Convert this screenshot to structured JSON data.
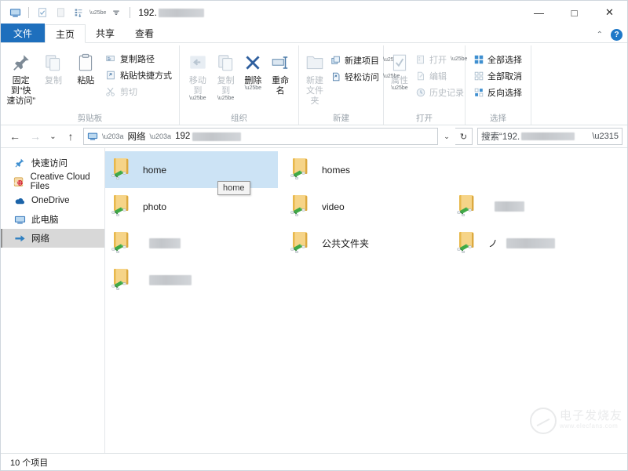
{
  "window": {
    "title_prefix": "192.",
    "title_redacted_width": 58,
    "quick_access_icons": [
      "computer-icon",
      "properties-icon",
      "new-folder-icon",
      "customize-icon",
      "dropdown-caret-icon"
    ],
    "controls": {
      "minimize": "—",
      "maximize": "□",
      "close": "✕"
    }
  },
  "tabs": {
    "file": "文件",
    "items": [
      {
        "label": "主页",
        "active": true
      },
      {
        "label": "共享",
        "active": false
      },
      {
        "label": "查看",
        "active": false
      }
    ],
    "collapse_ribbon": "⌃",
    "help": "?"
  },
  "ribbon": {
    "groups": [
      {
        "label": "剪贴板",
        "big": [
          {
            "label1": "固定到“快",
            "label2": "速访问”",
            "icon": "pin-icon",
            "dim": false
          },
          {
            "label1": "复制",
            "label2": "",
            "icon": "copy-icon",
            "dim": true
          },
          {
            "label1": "粘贴",
            "label2": "",
            "icon": "paste-icon",
            "dim": false
          }
        ],
        "small": [
          {
            "label": "复制路径",
            "icon": "copy-path-icon",
            "dim": false
          },
          {
            "label": "粘贴快捷方式",
            "icon": "paste-shortcut-icon",
            "dim": false
          },
          {
            "label": "剪切",
            "icon": "scissors-icon",
            "dim": true
          }
        ]
      },
      {
        "label": "组织",
        "big": [
          {
            "label1": "移动到",
            "label2": "",
            "icon": "move-to-icon",
            "dim": true,
            "caret": true
          },
          {
            "label1": "复制到",
            "label2": "",
            "icon": "copy-to-icon",
            "dim": true,
            "caret": true
          },
          {
            "label1": "删除",
            "label2": "",
            "icon": "delete-x-icon",
            "dim": false,
            "caret": true
          },
          {
            "label1": "重命名",
            "label2": "",
            "icon": "rename-icon",
            "dim": false
          }
        ],
        "small": []
      },
      {
        "label": "新建",
        "big": [
          {
            "label1": "新建",
            "label2": "文件夹",
            "icon": "new-folder-icon",
            "dim": true
          }
        ],
        "small": [
          {
            "label": "新建项目",
            "icon": "new-item-icon",
            "dim": false,
            "caret": true
          },
          {
            "label": "轻松访问",
            "icon": "easy-access-icon",
            "dim": false,
            "caret": true
          }
        ]
      },
      {
        "label": "打开",
        "big": [
          {
            "label1": "属性",
            "label2": "",
            "icon": "properties-icon",
            "dim": true,
            "caret": true
          }
        ],
        "small": [
          {
            "label": "打开",
            "icon": "open-icon",
            "dim": true,
            "caret": true
          },
          {
            "label": "编辑",
            "icon": "edit-icon",
            "dim": true
          },
          {
            "label": "历史记录",
            "icon": "history-icon",
            "dim": true
          }
        ]
      },
      {
        "label": "选择",
        "big": [],
        "small": [
          {
            "label": "全部选择",
            "icon": "select-all-icon",
            "dim": false
          },
          {
            "label": "全部取消",
            "icon": "select-none-icon",
            "dim": false
          },
          {
            "label": "反向选择",
            "icon": "invert-selection-icon",
            "dim": false
          }
        ]
      }
    ]
  },
  "address": {
    "back": "←",
    "forward": "→",
    "recent": "⌄",
    "up": "↑",
    "computer_icon": "computer-icon",
    "crumbs": [
      {
        "label": "网络",
        "redacted": false
      },
      {
        "label": "192",
        "redacted": true,
        "redact_width": 62
      }
    ],
    "dropdown": "⌄",
    "refresh": "↻",
    "search": {
      "value": "搜索“192.",
      "redact_width": 68,
      "icon": "search-icon"
    }
  },
  "sidebar": {
    "items": [
      {
        "label": "快速访问",
        "icon": "pin-star-icon",
        "selected": false
      },
      {
        "label": "Creative Cloud Files",
        "icon": "creative-cloud-icon",
        "selected": false
      },
      {
        "label": "OneDrive",
        "icon": "onedrive-cloud-icon",
        "selected": false
      },
      {
        "label": "此电脑",
        "icon": "computer-icon",
        "selected": false
      },
      {
        "label": "网络",
        "icon": "network-icon",
        "selected": true
      }
    ]
  },
  "files": {
    "items": [
      {
        "name": "home",
        "redacted": false,
        "redact_width": 0,
        "selected": true,
        "col": 0,
        "row": 0
      },
      {
        "name": "homes",
        "redacted": false,
        "redact_width": 0,
        "selected": false,
        "col": 1,
        "row": 0
      },
      {
        "name": "photo",
        "redacted": false,
        "redact_width": 0,
        "selected": false,
        "col": 0,
        "row": 1
      },
      {
        "name": "video",
        "redacted": false,
        "redact_width": 0,
        "selected": false,
        "col": 1,
        "row": 1
      },
      {
        "name": "",
        "redacted": true,
        "redact_width": 38,
        "selected": false,
        "col": 2,
        "row": 1
      },
      {
        "name": "",
        "redacted": true,
        "redact_width": 40,
        "selected": false,
        "col": 0,
        "row": 2
      },
      {
        "name": "公共文件夹",
        "redacted": false,
        "redact_width": 0,
        "selected": false,
        "col": 1,
        "row": 2
      },
      {
        "name": "ノ",
        "redacted": true,
        "redact_width": 62,
        "selected": false,
        "col": 2,
        "row": 2
      },
      {
        "name": "",
        "redacted": true,
        "redact_width": 54,
        "selected": false,
        "col": 0,
        "row": 3
      }
    ],
    "tooltip": "home"
  },
  "status": {
    "item_count": "10 个项目"
  },
  "watermark": {
    "cn": "电子发烧友",
    "en": "www.elecfans.com"
  },
  "colors": {
    "accent": "#1e6fbd",
    "selection": "#cce3f5",
    "folder": "#f0c14b",
    "share_green": "#4caf50"
  }
}
